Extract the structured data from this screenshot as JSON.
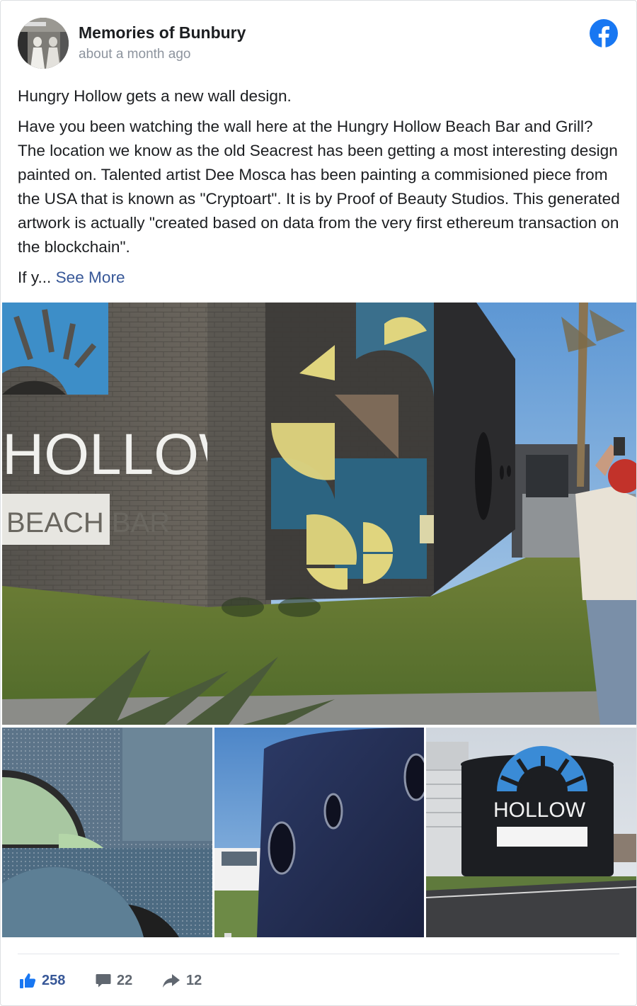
{
  "post": {
    "page_name": "Memories of Bunbury",
    "timestamp": "about a month ago",
    "logo_icon": "facebook-logo-icon",
    "paragraphs": [
      "Hungry Hollow gets a new wall design.",
      "Have you been watching the wall here at the Hungry Hollow Beach Bar and Grill? The location we know as the old Seacrest has been getting a most interesting design painted on. Talented artist Dee Mosca has been painting a commisioned piece from the USA that is known as \"Cryptoart\". It is by Proof of Beauty Studios. This generated artwork is actually \"created based on data from the very first ethereum transaction on the blockchain\"."
    ],
    "truncated_text": "If y...",
    "see_more_label": "See More"
  },
  "photos": {
    "main_sign_word": "HOLLOW",
    "main_sign_sub": "BEACH BAR",
    "third_sign_word": "HOLLOW"
  },
  "reactions": {
    "likes": "258",
    "comments": "22",
    "shares": "12",
    "like_icon": "thumbs-up-icon",
    "comment_icon": "comment-bubble-icon",
    "share_icon": "share-arrow-icon"
  },
  "colors": {
    "facebook_blue": "#1877f2",
    "link_blue": "#385898",
    "meta_gray": "#8d949e"
  }
}
